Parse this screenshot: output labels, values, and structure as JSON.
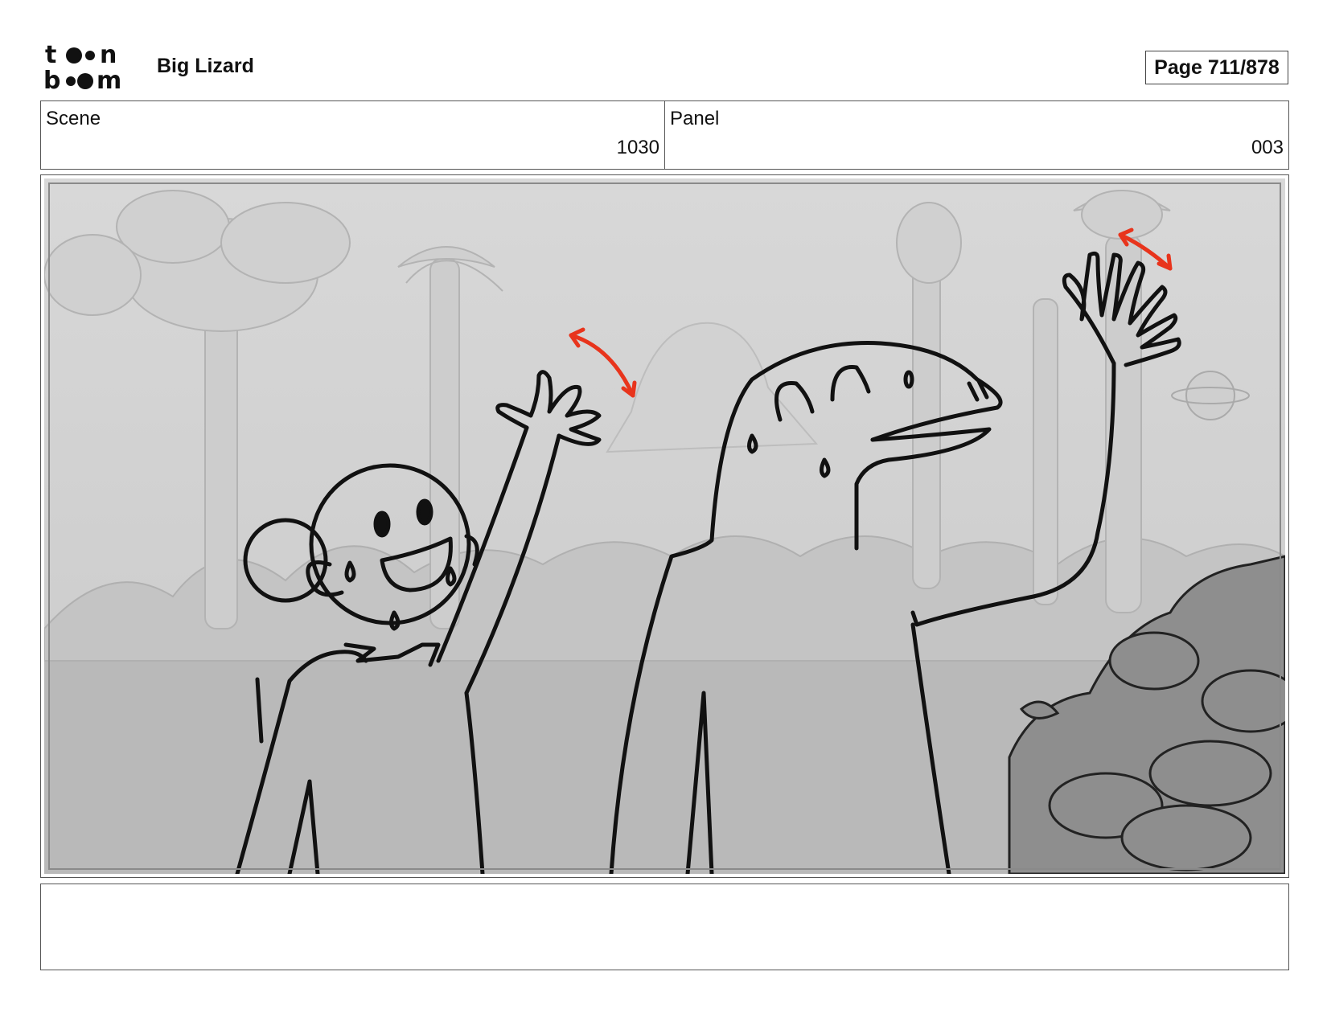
{
  "header": {
    "logo_text": "toon boom",
    "project_title": "Big Lizard",
    "page_label": "Page 711/878"
  },
  "info": {
    "scene_label": "Scene",
    "scene_value": "1030",
    "panel_label": "Panel",
    "panel_value": "003"
  },
  "panel": {
    "image_description_hidden": "",
    "motion_arrow_color": "#e8341c"
  },
  "notes": {
    "text": ""
  }
}
